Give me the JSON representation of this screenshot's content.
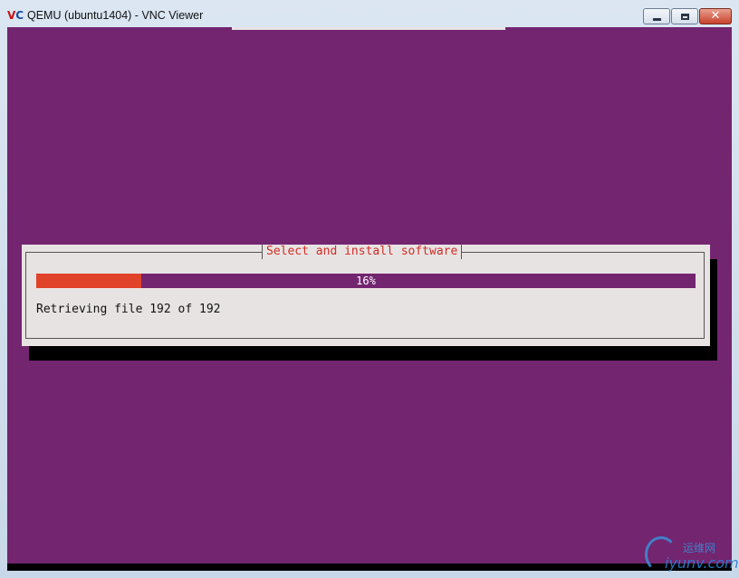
{
  "window": {
    "title": "QEMU (ubuntu1404) - VNC Viewer",
    "icon": "vnc-viewer-icon",
    "icon_text_v": "V",
    "icon_text_c": "C",
    "controls": {
      "close_glyph": "✕"
    }
  },
  "installer": {
    "dialog_title": "Select and install software",
    "progress": {
      "percent": 16,
      "label": "16%"
    },
    "status_text": "Retrieving file 192 of 192"
  },
  "watermark": {
    "cn": "运维网",
    "url": "iyunv.com"
  },
  "colors": {
    "screen_bg": "#732570",
    "dialog_bg": "#e8e3e3",
    "title_text": "#d12e24",
    "progress_fill": "#e0422a"
  }
}
